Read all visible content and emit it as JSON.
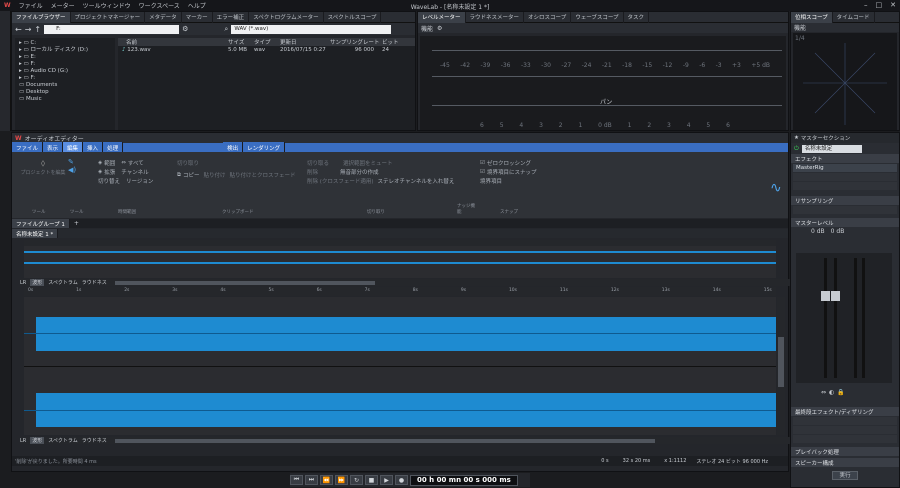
{
  "menubar": {
    "items": [
      "ファイル",
      "メーター",
      "ツールウィンドウ",
      "ワークスペース",
      "ヘルプ"
    ],
    "title": "WaveLab - [名称未設定 1 *]"
  },
  "left_tabs": [
    "ファイルブラウザー",
    "プロジェクトマネージャー",
    "メタデータ",
    "マーカー",
    "エラー補正",
    "スペクトログラムメーター",
    "スペクトルスコープ"
  ],
  "browser": {
    "path": "F:",
    "filter": "WAV (*.wav)",
    "tree": [
      "C:",
      "ローカル ディスク (D:)",
      "E:",
      "F:",
      "Audio CD (G:)",
      "F:"
    ],
    "places": [
      "Documents",
      "Desktop",
      "Music"
    ],
    "columns": [
      "名前",
      "サイズ",
      "タイプ",
      "更新日",
      "サンプリングレート",
      "ビット"
    ],
    "files": [
      {
        "name": "123.wav",
        "size": "5.0 MB",
        "type": "wav",
        "date": "2016/07/15 0:27",
        "rate": "96 000",
        "bits": "24"
      }
    ]
  },
  "meter_tabs": [
    "レベルメーター",
    "ラウドネスメーター",
    "オシロスコープ",
    "ウェーブスコープ",
    "タスク"
  ],
  "meter": {
    "label": "機能",
    "scale": [
      "-45",
      "-42",
      "-39",
      "-36",
      "-33",
      "-30",
      "-27",
      "-24",
      "-21",
      "-18",
      "-15",
      "-12",
      "-9",
      "-6",
      "-3",
      "+3",
      "+5 dB"
    ],
    "pan_label": "パン",
    "pan_scale": [
      "6",
      "5",
      "4",
      "3",
      "2",
      "1",
      "0 dB",
      "1",
      "2",
      "3",
      "4",
      "5",
      "6"
    ]
  },
  "scope_tabs": [
    "位相スコープ",
    "タイムコード"
  ],
  "scope": {
    "label": "機能",
    "corner": "1/4"
  },
  "editor": {
    "title": "オーディオエディター",
    "tabs": [
      "ファイル",
      "表示",
      "編集",
      "挿入",
      "処理",
      "検出",
      "レンダリング"
    ],
    "ribbon": {
      "tool": {
        "label": "プロジェクトを編集",
        "group": "ツール"
      },
      "view": {
        "group": "ツール"
      },
      "select": {
        "items": [
          "範囲",
          "すべて",
          "拡張",
          "チャンネル",
          "切り替え",
          "リージョン"
        ],
        "group": "時間範囲"
      },
      "clipboard": {
        "items": [
          "切り取り",
          "コピー",
          "貼り付け",
          "貼り付けとクロスフェード"
        ],
        "group": "クリップボード"
      },
      "cutting": {
        "items": [
          "切り取る",
          "削除",
          "削除 (クロスフェード適用)",
          "選択範囲をミュート",
          "無音部分の作成",
          "ステレオチャンネルを入れ替え"
        ],
        "group": "切り取り"
      },
      "snap": {
        "items": [
          "ゼロクロッシング",
          "境界項目にスナップ",
          "境界項目"
        ],
        "group": "スナップ"
      },
      "small": {
        "group": "ナッジ機能"
      }
    },
    "file_group": "ファイルグループ 1",
    "doc_tab": "名称未設定 1 *",
    "view_tabs": [
      "LR",
      "波形",
      "スペクトラム",
      "ラウドネス"
    ],
    "ruler": [
      "0s",
      "1s",
      "2s",
      "3s",
      "4s",
      "5s",
      "6s",
      "7s",
      "8s",
      "9s",
      "10s",
      "11s",
      "12s",
      "13s",
      "14s",
      "15s"
    ],
    "status": "'削除'が戻りました。所要時間 4 ms",
    "footer": {
      "pos": "0 s",
      "len": "32 s 20 ms",
      "zoom": "x 1:1112",
      "fmt": "ステレオ 24 ビット 96 000 Hz"
    }
  },
  "transport": {
    "time": "00 h 00 mn 00 s 000 ms"
  },
  "master": {
    "title": "マスターセクション",
    "preset": "名称未設定",
    "effects_label": "エフェクト",
    "plugin": "MasterRig",
    "resample": "リサンプリング",
    "level": "マスターレベル",
    "db_l": "0 dB",
    "db_r": "0 dB",
    "final": "最終段エフェクト/ディザリング",
    "playback": "プレイバック処理",
    "speaker": "スピーカー構成",
    "render": "実行"
  }
}
